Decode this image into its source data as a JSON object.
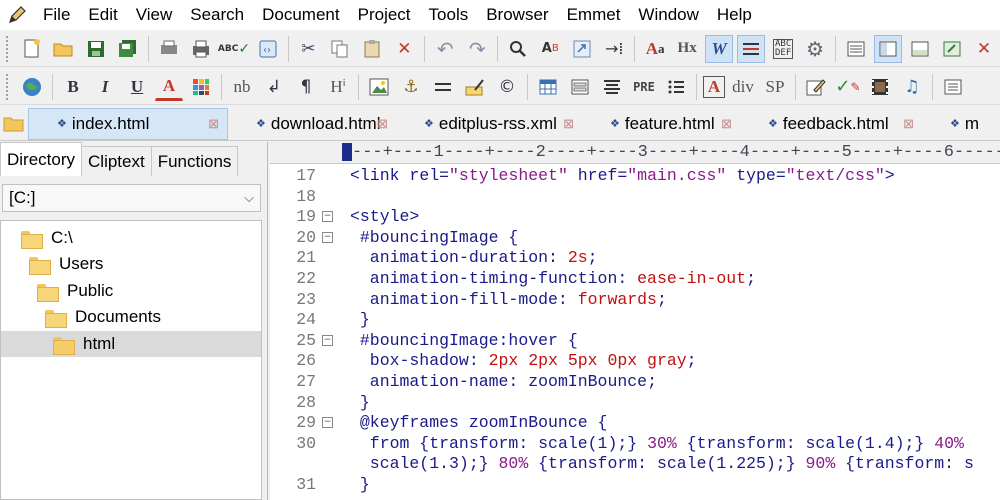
{
  "menubar": {
    "items": [
      "File",
      "Edit",
      "View",
      "Search",
      "Document",
      "Project",
      "Tools",
      "Browser",
      "Emmet",
      "Window",
      "Help"
    ]
  },
  "toolbar1": {
    "buttons": [
      {
        "name": "new-file-icon"
      },
      {
        "name": "open-folder-icon"
      },
      {
        "name": "save-icon"
      },
      {
        "name": "save-all-icon"
      },
      {
        "name": "print-preview-icon"
      },
      {
        "name": "print-icon"
      },
      {
        "name": "spellcheck-icon"
      },
      {
        "name": "browser-preview-icon"
      },
      {
        "name": "cut-icon"
      },
      {
        "name": "copy-icon"
      },
      {
        "name": "paste-icon"
      },
      {
        "name": "delete-icon"
      },
      {
        "name": "undo-icon"
      },
      {
        "name": "redo-icon"
      },
      {
        "name": "find-icon"
      },
      {
        "name": "replace-icon"
      },
      {
        "name": "go-to-icon"
      },
      {
        "name": "indent-icon"
      },
      {
        "name": "font-size-icon",
        "label": "Aa"
      },
      {
        "name": "hex-view-icon",
        "label": "Hx"
      },
      {
        "name": "word-wrap-icon",
        "label": "W"
      },
      {
        "name": "line-numbers-icon"
      },
      {
        "name": "column-select-icon"
      },
      {
        "name": "settings-icon"
      },
      {
        "name": "window-layout-icon"
      },
      {
        "name": "directory-window-icon"
      },
      {
        "name": "output-window-icon"
      },
      {
        "name": "fullscreen-icon"
      },
      {
        "name": "close-icon"
      }
    ]
  },
  "toolbar2": {
    "buttons": [
      {
        "name": "globe-icon"
      },
      {
        "name": "bold-icon",
        "label": "B"
      },
      {
        "name": "italic-icon",
        "label": "I"
      },
      {
        "name": "underline-icon",
        "label": "U"
      },
      {
        "name": "text-color-icon",
        "label": "A"
      },
      {
        "name": "color-palette-icon"
      },
      {
        "name": "nbsp-icon",
        "label": "nb"
      },
      {
        "name": "line-break-icon",
        "label": "↲"
      },
      {
        "name": "paragraph-icon",
        "label": "¶"
      },
      {
        "name": "heading-icon",
        "label": "Hⁱ"
      },
      {
        "name": "image-icon"
      },
      {
        "name": "anchor-icon",
        "label": "⚓"
      },
      {
        "name": "horizontal-rule-icon"
      },
      {
        "name": "comment-icon"
      },
      {
        "name": "copyright-icon",
        "label": "©"
      },
      {
        "name": "table-icon"
      },
      {
        "name": "form-icon"
      },
      {
        "name": "align-icon"
      },
      {
        "name": "pre-icon",
        "label": "PRE"
      },
      {
        "name": "list-icon"
      },
      {
        "name": "font-tag-icon",
        "label": "A"
      },
      {
        "name": "div-icon",
        "label": "div"
      },
      {
        "name": "span-icon",
        "label": "SP"
      },
      {
        "name": "edit-icon"
      },
      {
        "name": "validate-icon"
      },
      {
        "name": "video-icon"
      },
      {
        "name": "audio-icon",
        "label": "♫"
      },
      {
        "name": "code-snippet-icon"
      }
    ]
  },
  "tabs": [
    {
      "label": "index.html",
      "active": true
    },
    {
      "label": "download.html",
      "active": false
    },
    {
      "label": "editplus-rss.xml",
      "active": false
    },
    {
      "label": "feature.html",
      "active": false
    },
    {
      "label": "feedback.html",
      "active": false
    },
    {
      "label": "m",
      "active": false
    }
  ],
  "leftpanel": {
    "tabs": [
      "Directory",
      "Cliptext",
      "Functions"
    ],
    "drive": "[C:]",
    "tree": [
      {
        "label": "C:\\",
        "depth": 0
      },
      {
        "label": "Users",
        "depth": 1
      },
      {
        "label": "Public",
        "depth": 2
      },
      {
        "label": "Documents",
        "depth": 3
      },
      {
        "label": "html",
        "depth": 4,
        "selected": true
      }
    ]
  },
  "editor": {
    "ruler": "---+----1----+----2----+----3----+----4----+----5----+----6-----",
    "lines": [
      {
        "n": "17",
        "fold": "",
        "parts": [
          [
            "tag",
            "<link "
          ],
          [
            "tag",
            "rel="
          ],
          [
            "str",
            "\"stylesheet\""
          ],
          [
            "tag",
            " href="
          ],
          [
            "str",
            "\"main.css\""
          ],
          [
            "tag",
            " type="
          ],
          [
            "str",
            "\"text/css\""
          ],
          [
            "tag",
            ">"
          ]
        ]
      },
      {
        "n": "18",
        "fold": "",
        "parts": []
      },
      {
        "n": "19",
        "fold": "⊟",
        "parts": [
          [
            "tag",
            "<style>"
          ]
        ]
      },
      {
        "n": "20",
        "fold": "⊟",
        "parts": [
          [
            "sel",
            " #bouncingImage {"
          ]
        ]
      },
      {
        "n": "21",
        "fold": "",
        "parts": [
          [
            "prop",
            "  animation-duration: "
          ],
          [
            "val",
            "2s"
          ],
          [
            "prop",
            ";"
          ]
        ]
      },
      {
        "n": "22",
        "fold": "",
        "parts": [
          [
            "prop",
            "  animation-timing-function: "
          ],
          [
            "val",
            "ease-in-out"
          ],
          [
            "prop",
            ";"
          ]
        ]
      },
      {
        "n": "23",
        "fold": "",
        "parts": [
          [
            "prop",
            "  animation-fill-mode: "
          ],
          [
            "val",
            "forwards"
          ],
          [
            "prop",
            ";"
          ]
        ]
      },
      {
        "n": "24",
        "fold": "",
        "parts": [
          [
            "sel",
            " }"
          ]
        ]
      },
      {
        "n": "25",
        "fold": "⊟",
        "parts": [
          [
            "sel",
            " #bouncingImage:hover {"
          ]
        ]
      },
      {
        "n": "26",
        "fold": "",
        "parts": [
          [
            "prop",
            "  box-shadow: "
          ],
          [
            "val",
            "2px 2px 5px 0px gray"
          ],
          [
            "prop",
            ";"
          ]
        ]
      },
      {
        "n": "27",
        "fold": "",
        "parts": [
          [
            "prop",
            "  animation-name: "
          ],
          [
            "plain",
            "zoomInBounce"
          ],
          [
            "prop",
            ";"
          ]
        ]
      },
      {
        "n": "28",
        "fold": "",
        "parts": [
          [
            "sel",
            " }"
          ]
        ]
      },
      {
        "n": "29",
        "fold": "⊟",
        "parts": [
          [
            "sel",
            " @keyframes zoomInBounce {"
          ]
        ]
      },
      {
        "n": "30",
        "fold": "",
        "parts": [
          [
            "prop",
            "  from {transform: "
          ],
          [
            "plain",
            "scale(1);} "
          ],
          [
            "num",
            "30%"
          ],
          [
            "prop",
            " {transform: "
          ],
          [
            "plain",
            "scale(1.4);} "
          ],
          [
            "num",
            "40%"
          ]
        ]
      },
      {
        "n": "",
        "fold": "",
        "parts": [
          [
            "plain",
            "  scale(1.3);} "
          ],
          [
            "num",
            "80%"
          ],
          [
            "prop",
            " {transform: "
          ],
          [
            "plain",
            "scale(1.225);} "
          ],
          [
            "num",
            "90%"
          ],
          [
            "prop",
            " {transform: s"
          ]
        ]
      },
      {
        "n": "31",
        "fold": "",
        "parts": [
          [
            "sel",
            " }"
          ]
        ]
      }
    ]
  },
  "colors": {
    "tag": "#1a1a8a",
    "string": "#8a1a8a",
    "value": "#c01010",
    "active_tab_bg": "#d5e6f7"
  }
}
